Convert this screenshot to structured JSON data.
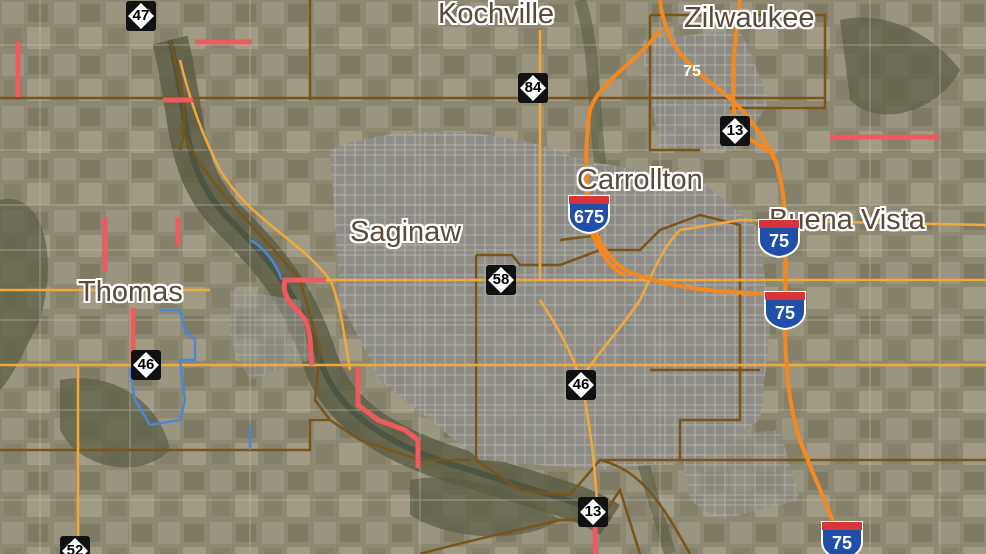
{
  "map": {
    "places": [
      {
        "id": "kochville",
        "label": "Kochville"
      },
      {
        "id": "zilwaukee",
        "label": "Zilwaukee"
      },
      {
        "id": "carrollton",
        "label": "Carrollton"
      },
      {
        "id": "buena-vista",
        "label": "Buena Vista"
      },
      {
        "id": "saginaw",
        "label": "Saginaw"
      },
      {
        "id": "thomas",
        "label": "Thomas"
      }
    ],
    "state_routes": [
      "47",
      "84",
      "13",
      "58",
      "46",
      "46",
      "13",
      "52"
    ],
    "interstates": [
      "75",
      "675",
      "75",
      "75",
      "75"
    ],
    "colors": {
      "freeway": "#f5891f",
      "arterial": "#f2a93b",
      "boundary": "#7a5518",
      "closure": "#ef5a5f",
      "trail": "#4a87d6"
    }
  }
}
